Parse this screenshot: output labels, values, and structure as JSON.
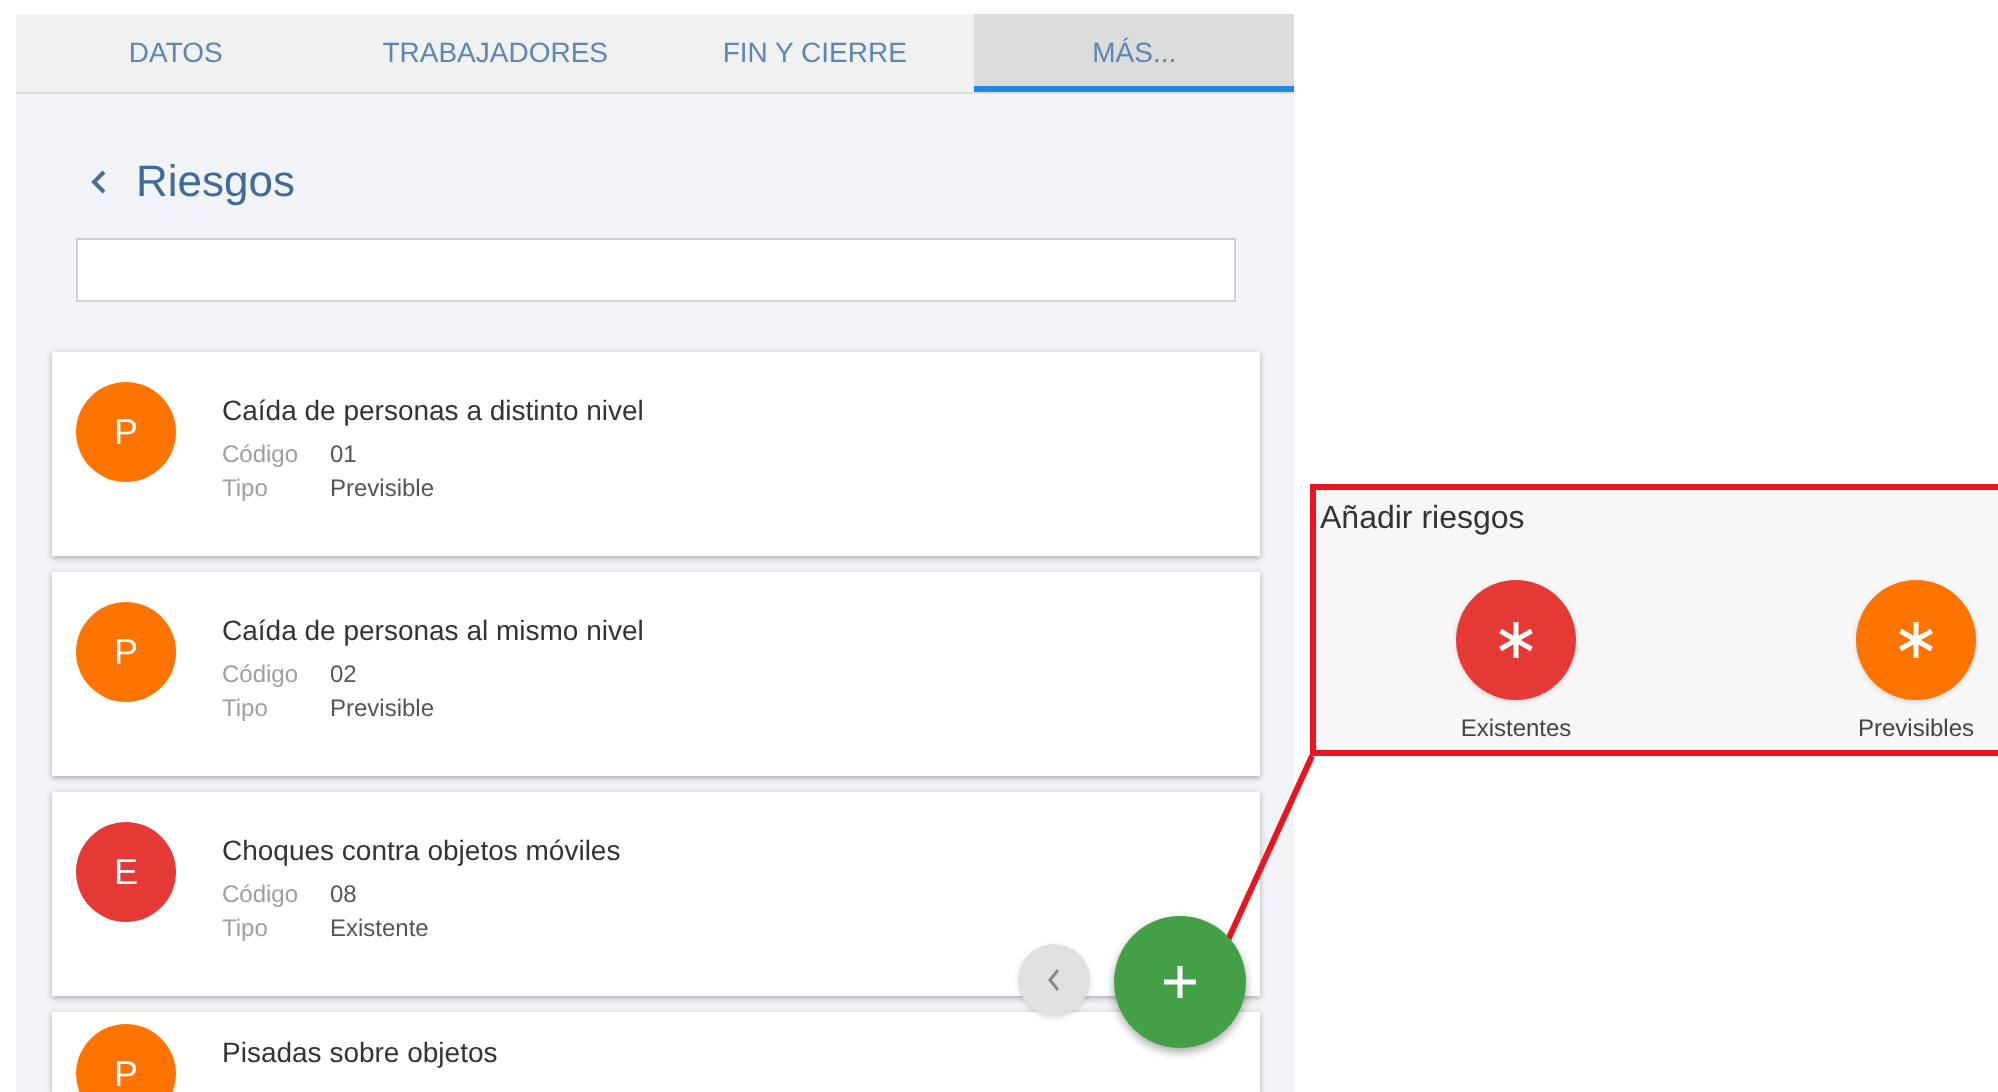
{
  "tabs": [
    {
      "label": "DATOS",
      "selected": false
    },
    {
      "label": "TRABAJADORES",
      "selected": false
    },
    {
      "label": "FIN Y CIERRE",
      "selected": false
    },
    {
      "label": "MÁS...",
      "selected": true
    }
  ],
  "header": {
    "title": "Riesgos"
  },
  "risks": [
    {
      "initial": "P",
      "color": "#ff7300",
      "title": "Caída de personas a distinto nivel",
      "code_label": "Código",
      "code": "01",
      "type_label": "Tipo",
      "type": "Previsible"
    },
    {
      "initial": "P",
      "color": "#ff7300",
      "title": "Caída de personas al mismo nivel",
      "code_label": "Código",
      "code": "02",
      "type_label": "Tipo",
      "type": "Previsible"
    },
    {
      "initial": "E",
      "color": "#e53935",
      "title": "Choques contra objetos móviles",
      "code_label": "Código",
      "code": "08",
      "type_label": "Tipo",
      "type": "Existente"
    },
    {
      "initial": "P",
      "color": "#ff7300",
      "title": "Pisadas sobre objetos"
    }
  ],
  "callout": {
    "title": "Añadir riesgos",
    "options": [
      {
        "label": "Existentes",
        "color": "#e53935"
      },
      {
        "label": "Previsibles",
        "color": "#ff7300"
      }
    ]
  }
}
